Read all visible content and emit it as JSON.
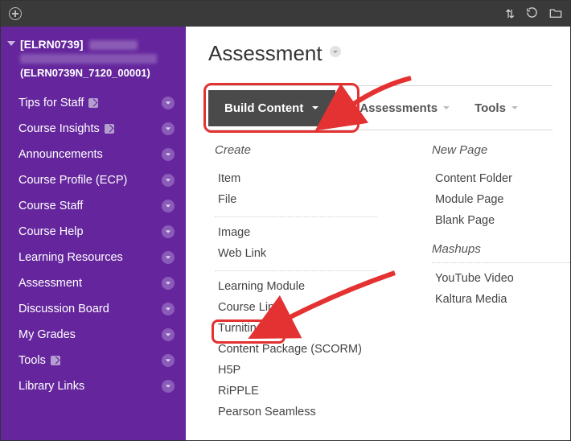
{
  "topbar": {
    "plus_icon": "add-icon",
    "swap_icon": "swap-icon",
    "refresh_icon": "refresh-icon",
    "folder_icon": "folder-icon"
  },
  "course": {
    "code_bracket": "[ELRN0739]",
    "id_line": "(ELRN0739N_7120_00001)"
  },
  "sidebar": {
    "items": [
      {
        "label": "Tips for Staff",
        "ext": true
      },
      {
        "label": "Course Insights",
        "ext": true
      },
      {
        "label": "Announcements",
        "ext": false
      },
      {
        "label": "Course Profile (ECP)",
        "ext": false
      },
      {
        "label": "Course Staff",
        "ext": false
      },
      {
        "label": "Course Help",
        "ext": false
      },
      {
        "label": "Learning Resources",
        "ext": false
      },
      {
        "label": "Assessment",
        "ext": false
      },
      {
        "label": "Discussion Board",
        "ext": false
      },
      {
        "label": "My Grades",
        "ext": false
      },
      {
        "label": "Tools",
        "ext": true
      },
      {
        "label": "Library Links",
        "ext": false
      }
    ]
  },
  "page": {
    "title": "Assessment"
  },
  "toolbar": {
    "build_label": "Build Content",
    "assessments_label": "Assessments",
    "tools_label": "Tools"
  },
  "dropdown": {
    "create_heading": "Create",
    "newpage_heading": "New Page",
    "mashups_heading": "Mashups",
    "create_g1": [
      "Item",
      "File"
    ],
    "create_g2": [
      "Image",
      "Web Link"
    ],
    "create_g3": [
      "Learning Module",
      "Course Link",
      "Turnitin",
      "Content Package (SCORM)",
      "H5P",
      "RiPPLE",
      "Pearson Seamless"
    ],
    "newpage": [
      "Content Folder",
      "Module Page",
      "Blank Page"
    ],
    "mashups": [
      "YouTube Video",
      "Kaltura Media"
    ]
  }
}
